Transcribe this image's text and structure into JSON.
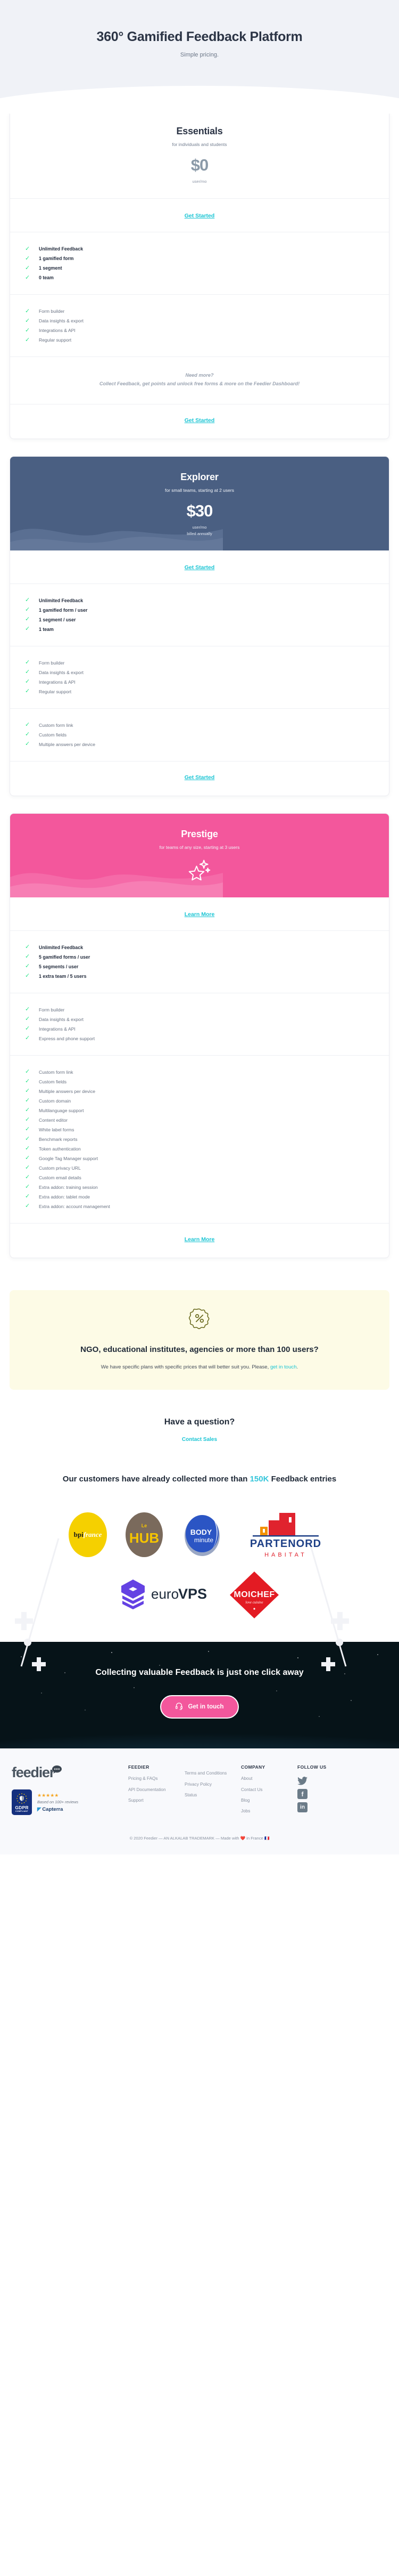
{
  "hero": {
    "title": "360° Gamified Feedback Platform",
    "subtitle": "Simple pricing."
  },
  "plans": [
    {
      "name": "Essentials",
      "description": "for individuals and students",
      "price": "$0",
      "unit": "user/mo",
      "billing": "",
      "cta_top": "Get Started",
      "cta_bottom": "Get Started",
      "features_primary": [
        "Unlimited Feedback",
        "1 gamified form",
        "1 segment",
        "0 team"
      ],
      "features_secondary": [
        "Form builder",
        "Data insights & export",
        "Integrations & API",
        "Regular support"
      ],
      "features_tertiary": [],
      "note_line1": "Need more?",
      "note_line2": "Collect Feedback, get points and unlock free forms & more on the Feedier Dashboard!"
    },
    {
      "name": "Explorer",
      "description": "for small teams, starting at 2 users",
      "price": "$30",
      "unit": "user/mo",
      "billing": "billed annually",
      "cta_top": "Get Started",
      "cta_bottom": "Get Started",
      "features_primary": [
        "Unlimited Feedback",
        "1 gamified form / user",
        "1 segment / user",
        "1 team"
      ],
      "features_secondary": [
        "Form builder",
        "Data insights & export",
        "Integrations & API",
        "Regular support"
      ],
      "features_tertiary": [
        "Custom form link",
        "Custom fields",
        "Multiple answers per device"
      ],
      "note_line1": "",
      "note_line2": ""
    },
    {
      "name": "Prestige",
      "description": "for teams of any size, starting at 3 users",
      "price": "",
      "unit": "",
      "billing": "",
      "cta_top": "Learn More",
      "cta_bottom": "Learn More",
      "features_primary": [
        "Unlimited Feedback",
        "5 gamified forms / user",
        "5 segments / user",
        "1 extra team / 5 users"
      ],
      "features_secondary": [
        "Form builder",
        "Data insights & export",
        "Integrations & API",
        "Express and phone support"
      ],
      "features_tertiary": [
        "Custom form link",
        "Custom fields",
        "Multiple answers per device",
        "Custom domain",
        "Multilanguage support",
        "Content editor",
        "White label forms",
        "Benchmark reports",
        "Token authentication",
        "Google Tag Manager support",
        "Custom privacy URL",
        "Custom email details",
        "Extra addon: training session",
        "Extra addon: tablet mode",
        "Extra addon: account management"
      ],
      "note_line1": "",
      "note_line2": ""
    }
  ],
  "ngo": {
    "icon": "discount-badge-icon",
    "title": "NGO, educational institutes, agencies or more than 100 users?",
    "text_before": "We have specific plans with specific prices that will better suit you. Please, ",
    "link": "get in touch",
    "text_after": "."
  },
  "question": {
    "title": "Have a question?",
    "link": "Contact Sales"
  },
  "customers": {
    "headline_before": "Our customers have already collected more than ",
    "headline_highlight": "150K",
    "headline_after": " Feedback entries",
    "logos": [
      "bpifrance",
      "Le HUB",
      "BODY minute",
      "PARTENORD HABITAT",
      "euroVPS",
      "MOICHEF"
    ]
  },
  "space_cta": {
    "title": "Collecting valuable Feedback is just one click away",
    "button": "Get in touch",
    "button_icon": "headset-icon"
  },
  "footer": {
    "brand": "feedier",
    "bubble_label": "FEEDIER",
    "gdpr_line1": "GDPR",
    "gdpr_line2": "COMPLIANT",
    "stars": "★★★★★",
    "reviews": "Based on 100+ reviews",
    "capterra": "Capterra",
    "columns": [
      {
        "title": "FEEDIER",
        "links": [
          "Pricing & FAQs",
          "API Documentation",
          "Support"
        ]
      },
      {
        "title": "",
        "links": [
          "Terms and Conditions",
          "Privacy Policy",
          "Status"
        ]
      },
      {
        "title": "COMPANY",
        "links": [
          "About",
          "Contact Us",
          "Blog",
          "Jobs"
        ]
      }
    ],
    "follow_title": "FOLLOW US",
    "socials": [
      "twitter-icon",
      "facebook-icon",
      "linkedin-icon"
    ],
    "copyright": "© 2020 Feedier — AN ALKALAB TRADEMARK — Made with ❤️ in France 🇫🇷"
  },
  "colors": {
    "accent": "#1bc5d4",
    "pink": "#f3579c",
    "blue": "#4a5f82",
    "tick": "#2ae58a",
    "cream": "#fdfbe6"
  }
}
